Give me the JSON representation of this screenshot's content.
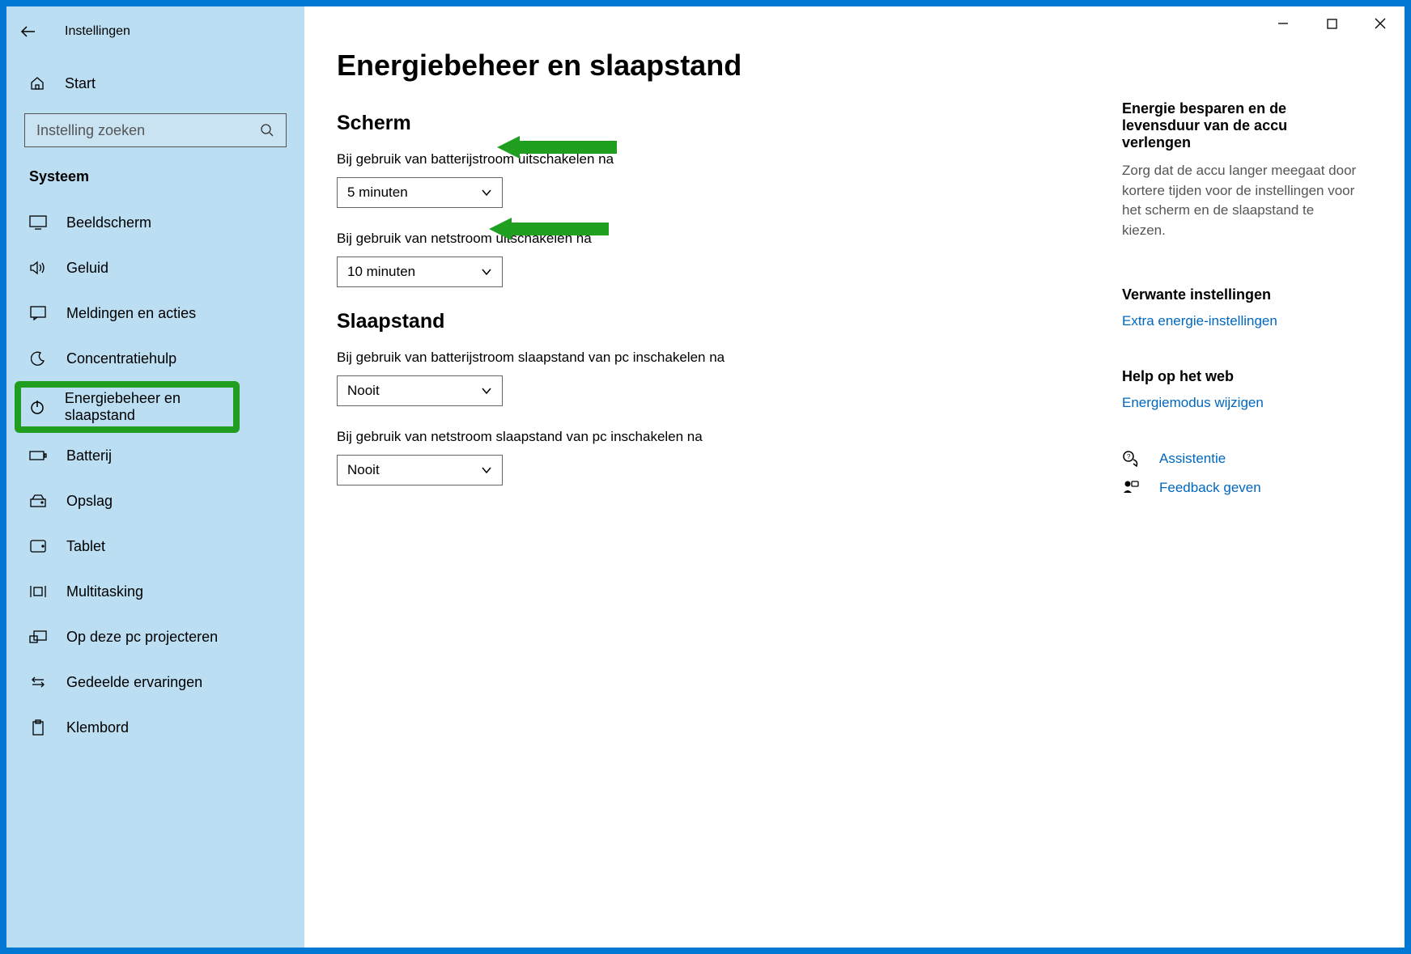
{
  "app_title": "Instellingen",
  "home_label": "Start",
  "search": {
    "placeholder": "Instelling zoeken"
  },
  "section_title": "Systeem",
  "sidebar": {
    "items": [
      {
        "label": "Beeldscherm"
      },
      {
        "label": "Geluid"
      },
      {
        "label": "Meldingen en acties"
      },
      {
        "label": "Concentratiehulp"
      },
      {
        "label": "Energiebeheer en slaapstand"
      },
      {
        "label": "Batterij"
      },
      {
        "label": "Opslag"
      },
      {
        "label": "Tablet"
      },
      {
        "label": "Multitasking"
      },
      {
        "label": "Op deze pc projecteren"
      },
      {
        "label": "Gedeelde ervaringen"
      },
      {
        "label": "Klembord"
      }
    ]
  },
  "page": {
    "title": "Energiebeheer en slaapstand",
    "screen_section": "Scherm",
    "screen_battery_label": "Bij gebruik van batterijstroom uitschakelen na",
    "screen_battery_value": "5 minuten",
    "screen_plugged_label": "Bij gebruik van netstroom uitschakelen na",
    "screen_plugged_value": "10 minuten",
    "sleep_section": "Slaapstand",
    "sleep_battery_label": "Bij gebruik van batterijstroom slaapstand van pc inschakelen na",
    "sleep_battery_value": "Nooit",
    "sleep_plugged_label": "Bij gebruik van netstroom slaapstand van pc inschakelen na",
    "sleep_plugged_value": "Nooit"
  },
  "aside": {
    "tip_title": "Energie besparen en de levensduur van de accu verlengen",
    "tip_body": "Zorg dat de accu langer meegaat door kortere tijden voor de instellingen voor het scherm en de slaapstand te kiezen.",
    "related_title": "Verwante instellingen",
    "related_link": "Extra energie-instellingen",
    "help_title": "Help op het web",
    "help_link": "Energiemodus wijzigen",
    "support_label": "Assistentie",
    "feedback_label": "Feedback geven"
  }
}
